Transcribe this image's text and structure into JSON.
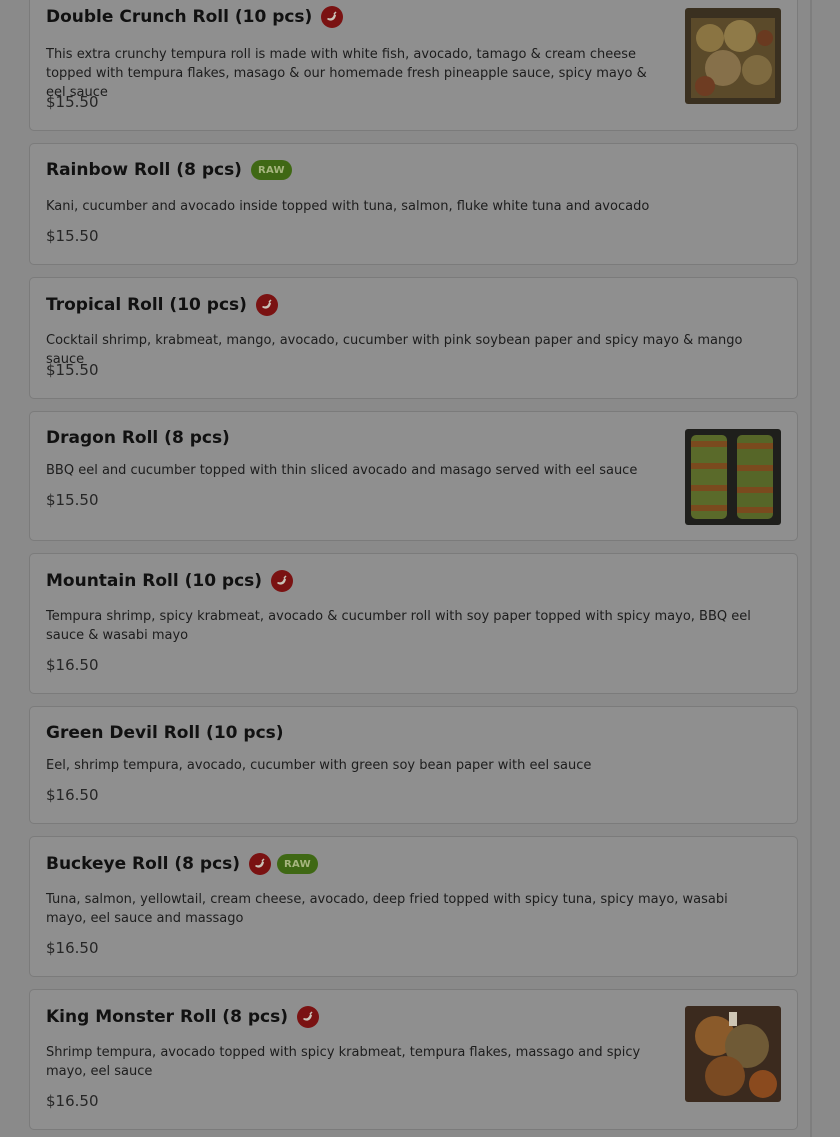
{
  "items": [
    {
      "name": "Double Crunch Roll (10 pcs)",
      "desc": "This extra crunchy tempura roll is made with white fish, avocado, tamago & cream cheese topped with tempura flakes, masago & our homemade fresh pineapple sauce, spicy mayo & eel sauce",
      "price": "$15.50",
      "spicy": true,
      "raw": false,
      "image": true
    },
    {
      "name": "Rainbow Roll (8 pcs)",
      "desc": "Kani, cucumber and avocado inside topped with tuna, salmon, fluke white tuna and avocado",
      "price": "$15.50",
      "spicy": false,
      "raw": true,
      "image": false
    },
    {
      "name": "Tropical Roll (10 pcs)",
      "desc": "Cocktail shrimp, krabmeat, mango, avocado, cucumber with pink soybean paper and spicy mayo & mango sauce",
      "price": "$15.50",
      "spicy": true,
      "raw": false,
      "image": false
    },
    {
      "name": "Dragon Roll (8 pcs)",
      "desc": "BBQ eel and cucumber topped with thin sliced avocado and masago served with eel sauce",
      "price": "$15.50",
      "spicy": false,
      "raw": false,
      "image": true
    },
    {
      "name": "Mountain Roll (10 pcs)",
      "desc": "Tempura shrimp, spicy krabmeat, avocado & cucumber roll with soy paper topped with spicy mayo, BBQ eel sauce & wasabi mayo",
      "price": "$16.50",
      "spicy": true,
      "raw": false,
      "image": false
    },
    {
      "name": "Green Devil Roll (10 pcs)",
      "desc": "Eel, shrimp tempura, avocado, cucumber with green soy bean paper with eel sauce",
      "price": "$16.50",
      "spicy": false,
      "raw": false,
      "image": false
    },
    {
      "name": "Buckeye Roll (8 pcs)",
      "desc": "Tuna, salmon, yellowtail, cream cheese, avocado, deep fried topped with spicy tuna, spicy mayo, wasabi mayo, eel sauce and massago",
      "price": "$16.50",
      "spicy": true,
      "raw": true,
      "image": false
    },
    {
      "name": "King Monster Roll (8 pcs)",
      "desc": "Shrimp tempura, avocado topped with spicy krabmeat, tempura flakes, massago and spicy mayo, eel sauce",
      "price": "$16.50",
      "spicy": true,
      "raw": false,
      "image": true
    }
  ],
  "badges": {
    "raw_label": "RAW"
  },
  "icons": {
    "spicy": "chili-pepper-icon"
  },
  "colors": {
    "overlay": "#8a8a8a",
    "pepper_bg": "#7a1212",
    "raw_bg": "#3f6814"
  }
}
